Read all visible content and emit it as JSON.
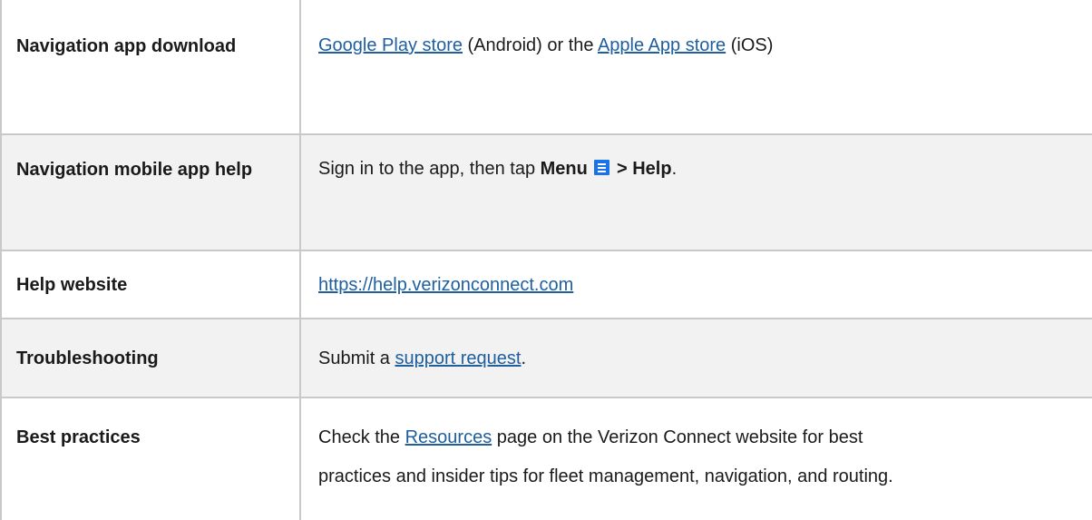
{
  "rows": [
    {
      "label": "Navigation app download",
      "link1": "Google Play store",
      "text1": " (Android) or the ",
      "link2": "Apple App store",
      "text2": " (iOS)"
    },
    {
      "label": "Navigation mobile app help",
      "text1": "Sign in to the app, then tap ",
      "bold1": "Menu",
      "icon": "menu-icon",
      "bold2": "> Help",
      "text2": "."
    },
    {
      "label": "Help website",
      "link1": "https://help.verizonconnect.com"
    },
    {
      "label": "Troubleshooting",
      "text1": "Submit a ",
      "link1": "support request",
      "text2": "."
    },
    {
      "label": "Best practices",
      "text1": "Check the ",
      "link1": "Resources",
      "text2": " page on the Verizon Connect website for best",
      "text3": "practices and insider tips for fleet management, navigation, and routing."
    }
  ],
  "colors": {
    "link": "#1f5fa0",
    "shaded_row": "#f2f2f2",
    "border": "#c9c9c9",
    "icon": "#1a73e8"
  }
}
